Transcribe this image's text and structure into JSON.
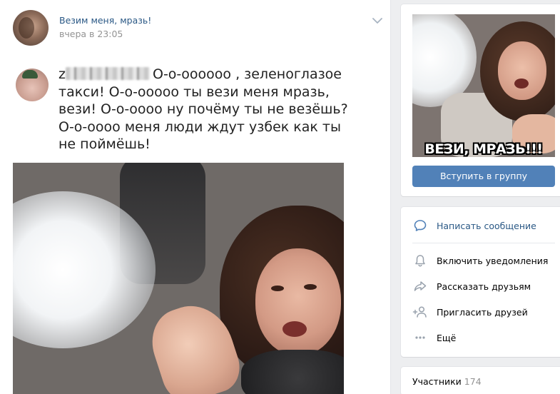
{
  "post": {
    "group_name": "Везим меня, мразь!",
    "time": "вчера в 23:05",
    "text": "О-о-оооооо , зеленоглазое такси! О-о-ооооо ты вези меня мразь, вези! О-о-оооо ну почёму ты не везёшь? О-о-оооо меня люди ждут узбек как ты не поймёшь!",
    "author_initial": "z"
  },
  "sidebar": {
    "cover_caption": "ВЕЗИ, МРАЗЬ!!!",
    "join_button": "Вступить в группу",
    "actions": [
      {
        "label": "Написать сообщение",
        "icon": "message-bubble-icon"
      },
      {
        "label": "Включить уведомления",
        "icon": "bell-icon"
      },
      {
        "label": "Рассказать друзьям",
        "icon": "share-arrow-icon"
      },
      {
        "label": "Пригласить друзей",
        "icon": "add-user-icon"
      },
      {
        "label": "Ещё",
        "icon": "more-dots-icon"
      }
    ],
    "members": {
      "label": "Участники",
      "count": "174"
    }
  },
  "colors": {
    "link": "#2a5885",
    "button": "#5181b8",
    "background": "#edeef0",
    "secondary_text": "#939393"
  }
}
